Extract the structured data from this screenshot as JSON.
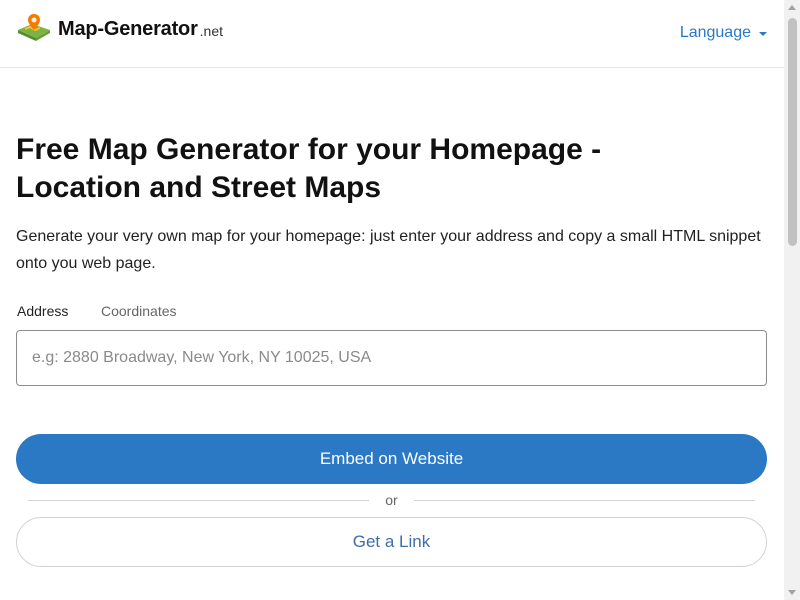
{
  "header": {
    "brand": "Map-Generator",
    "brand_tld": ".net",
    "language_label": "Language",
    "logo_icon": "map-logo-icon",
    "caret_icon": "caret-down-icon"
  },
  "main": {
    "title": "Free Map Generator for your Homepage - Location and Street Maps",
    "lead": "Generate your very own map for your homepage: just enter your address and copy a small HTML snippet onto you web page.",
    "tabs": [
      {
        "label": "Address",
        "active": true
      },
      {
        "label": "Coordinates",
        "active": false
      }
    ],
    "address_input": {
      "value": "",
      "placeholder": "e.g: 2880 Broadway, New York, NY 10025, USA"
    },
    "embed_button": "Embed on Website",
    "divider_text": "or",
    "link_button": "Get a Link"
  },
  "colors": {
    "accent": "#2b78c5",
    "link_text": "#3d6ea8",
    "text": "#212529"
  }
}
